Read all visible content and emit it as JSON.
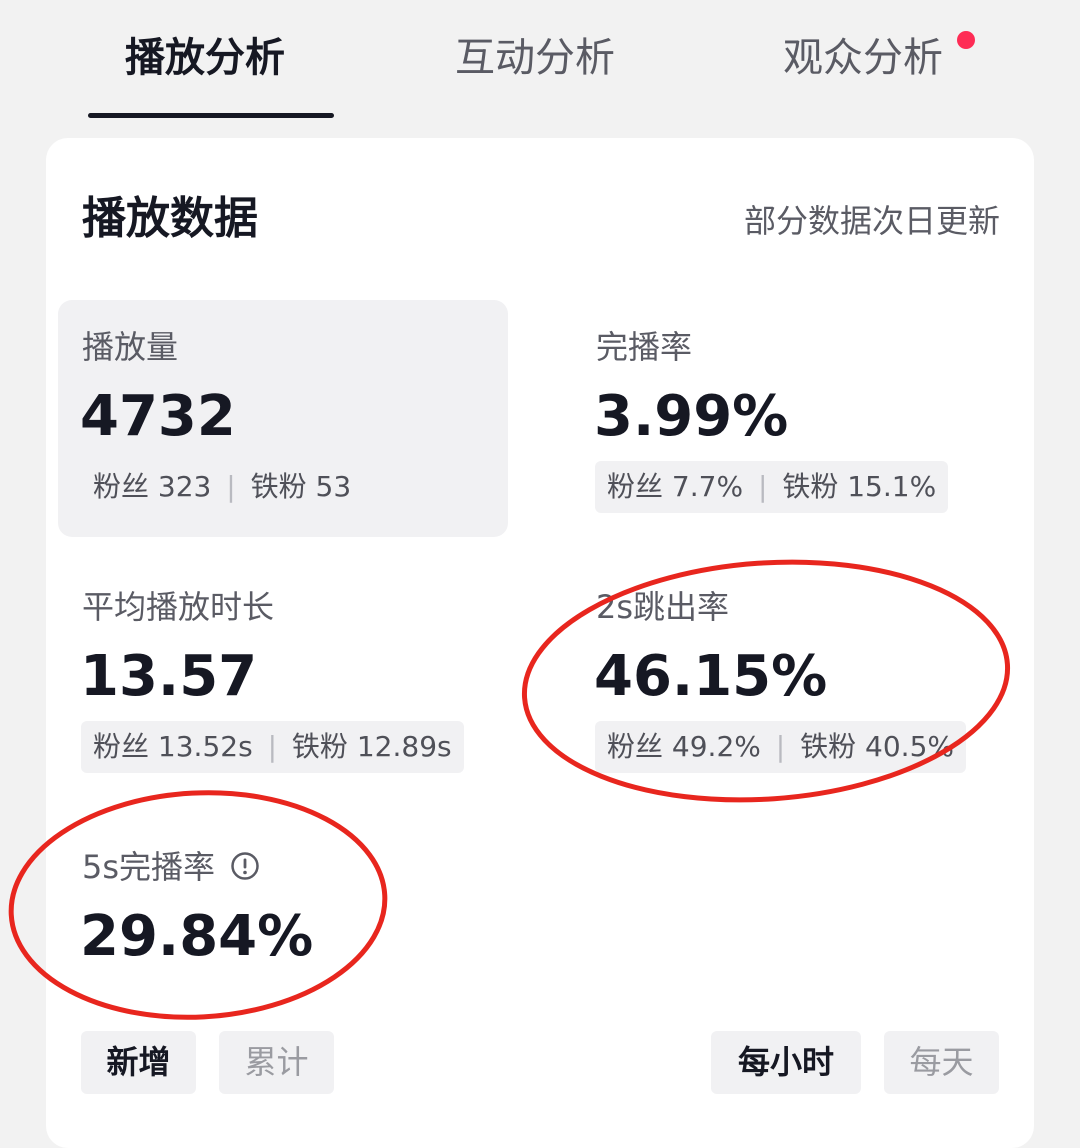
{
  "tabs": [
    {
      "label": "播放分析",
      "active": true
    },
    {
      "label": "互动分析",
      "active": false
    },
    {
      "label": "观众分析",
      "active": false,
      "has_badge": true
    }
  ],
  "card": {
    "title": "播放数据",
    "note": "部分数据次日更新"
  },
  "metrics": [
    {
      "label": "播放量",
      "value": "4732",
      "fans_label": "粉丝",
      "fans_value": "323",
      "iron_label": "铁粉",
      "iron_value": "53"
    },
    {
      "label": "完播率",
      "value": "3.99%",
      "fans_label": "粉丝",
      "fans_value": "7.7%",
      "iron_label": "铁粉",
      "iron_value": "15.1%"
    },
    {
      "label": "平均播放时长",
      "value": "13.57",
      "fans_label": "粉丝",
      "fans_value": "13.52s",
      "iron_label": "铁粉",
      "iron_value": "12.89s"
    },
    {
      "label": "2s跳出率",
      "value": "46.15%",
      "fans_label": "粉丝",
      "fans_value": "49.2%",
      "iron_label": "铁粉",
      "iron_value": "40.5%"
    },
    {
      "label": "5s完播率",
      "value": "29.84%"
    }
  ],
  "filters": {
    "mode": [
      {
        "label": "新增",
        "selected": true
      },
      {
        "label": "累计",
        "selected": false
      }
    ],
    "granularity": [
      {
        "label": "每小时",
        "selected": true
      },
      {
        "label": "每天",
        "selected": false
      }
    ]
  },
  "colors": {
    "text_primary": "#161823",
    "text_secondary": "#5a5b64",
    "badge": "#fe2c55",
    "annotation": "#e8261e"
  },
  "icons": {
    "info": "info-circle-icon"
  }
}
